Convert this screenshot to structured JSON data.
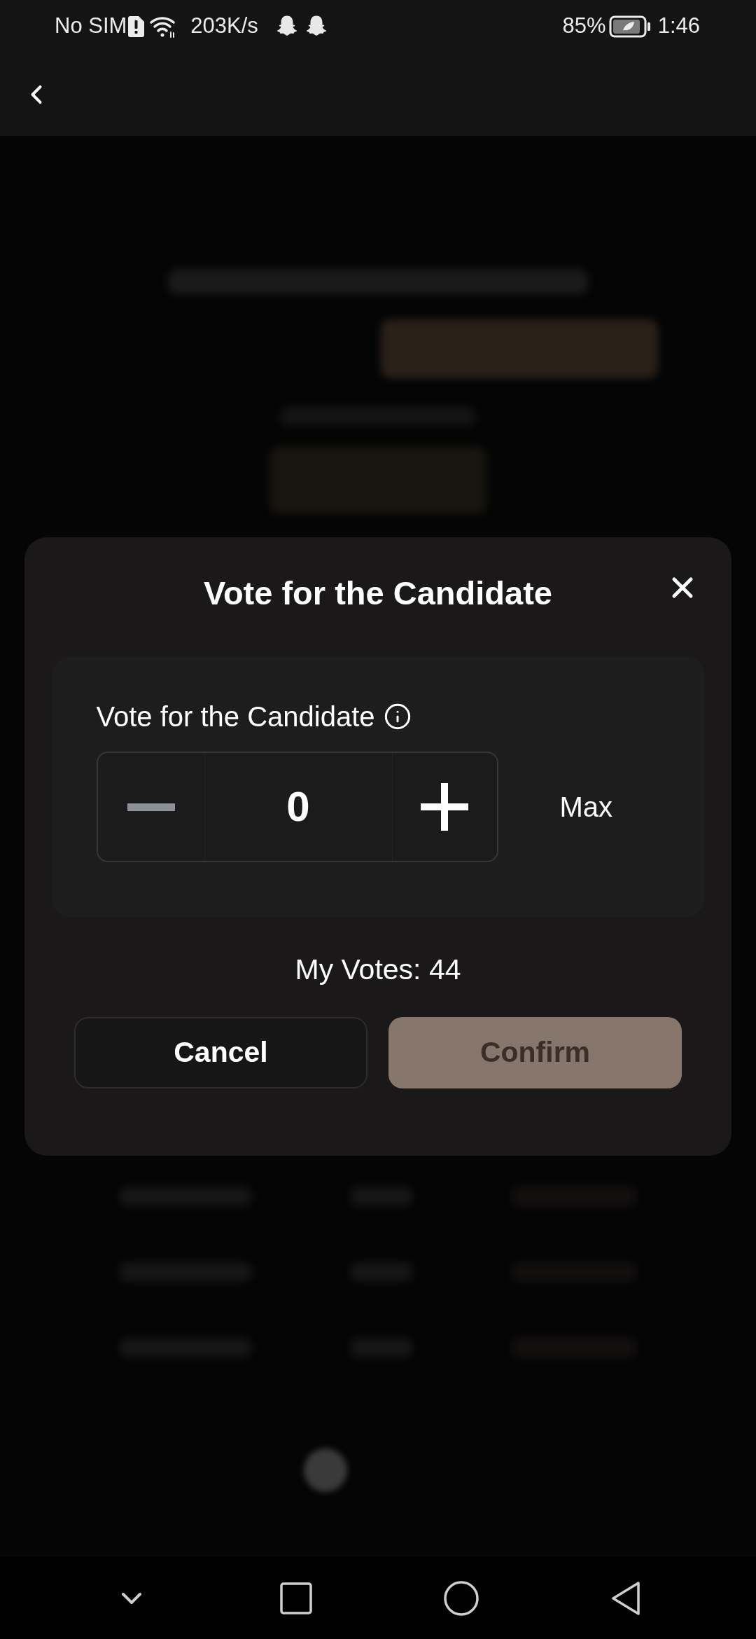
{
  "status_bar": {
    "carrier": "No SIM",
    "speed": "203K/s",
    "battery": "85%",
    "time": "1:46"
  },
  "modal": {
    "title": "Vote for the Candidate",
    "label": "Vote for the Candidate",
    "value": "0",
    "max_label": "Max",
    "my_votes": "My Votes: 44",
    "buttons": [
      {
        "label": "Cancel",
        "kind": "secondary"
      },
      {
        "label": "Confirm",
        "kind": "primary"
      }
    ]
  }
}
